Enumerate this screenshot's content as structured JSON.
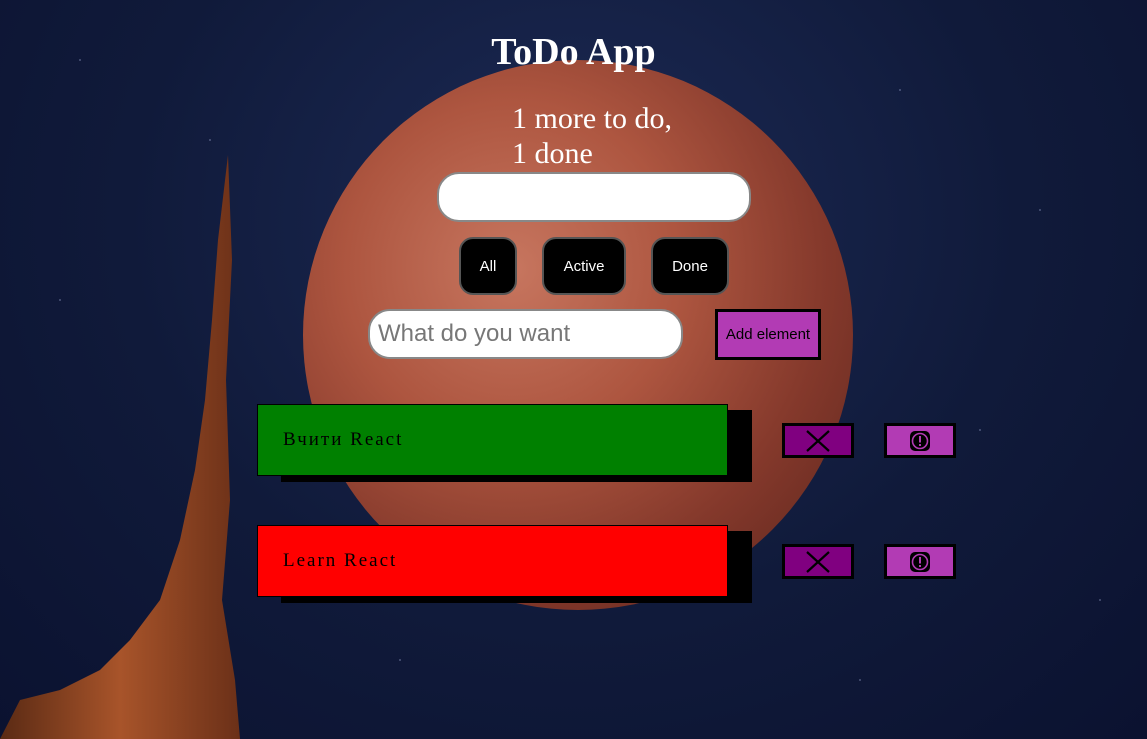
{
  "app": {
    "title": "ToDo App"
  },
  "status": {
    "line1": "1 more to do,",
    "line2": "1 done"
  },
  "search": {
    "value": "",
    "placeholder": ""
  },
  "filters": [
    {
      "label": "All"
    },
    {
      "label": "Active"
    },
    {
      "label": "Done"
    }
  ],
  "add_form": {
    "placeholder": "What do you want",
    "value": "",
    "button_label": "Add element"
  },
  "todos": [
    {
      "label": "Вчити React",
      "color": "#008000",
      "state": "done"
    },
    {
      "label": "Learn React",
      "color": "#ff0000",
      "state": "important"
    }
  ],
  "icons": {
    "delete": "close-icon",
    "important": "exclamation-icon"
  },
  "colors": {
    "delete_button": "#800080",
    "important_button": "#b23bb4",
    "add_button": "#b23bb4"
  }
}
